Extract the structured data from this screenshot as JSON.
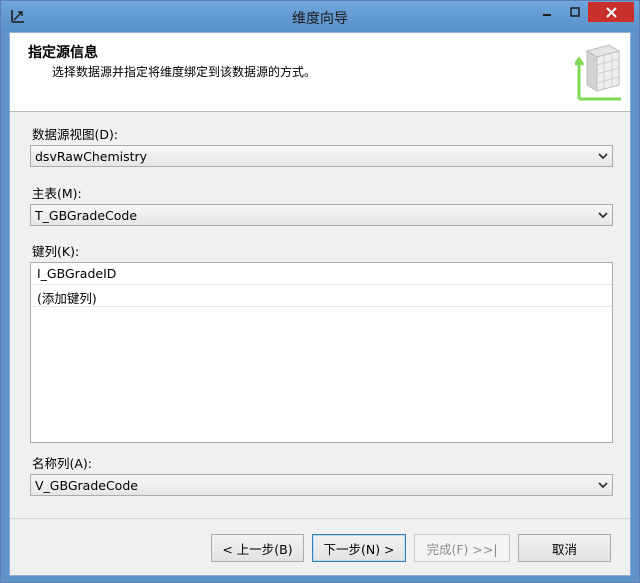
{
  "window": {
    "title": "维度向导",
    "colors": {
      "title_bar": "#6fa6dd",
      "close_button": "#c7302b",
      "dialog_bg": "#f0f0f0"
    }
  },
  "header": {
    "title": "指定源信息",
    "subtitle": "选择数据源并指定将维度绑定到该数据源的方式。"
  },
  "form": {
    "data_source_view": {
      "label": "数据源视图(D):",
      "value": "dsvRawChemistry"
    },
    "main_table": {
      "label": "主表(M):",
      "value": "T_GBGradeCode"
    },
    "key_columns": {
      "label": "键列(K):",
      "items": [
        "I_GBGradeID",
        "(添加键列)"
      ]
    },
    "name_column": {
      "label": "名称列(A):",
      "value": "V_GBGradeCode"
    }
  },
  "buttons": {
    "back": "< 上一步(B)",
    "next": "下一步(N) >",
    "finish": "完成(F) >>|",
    "cancel": "取消"
  },
  "icons": {
    "app": "dimension-wizard-icon",
    "minimize": "minimize-icon",
    "maximize": "maximize-icon",
    "close": "close-icon",
    "header_art": "dimension-cube-icon",
    "dropdown": "chevron-down-icon"
  }
}
